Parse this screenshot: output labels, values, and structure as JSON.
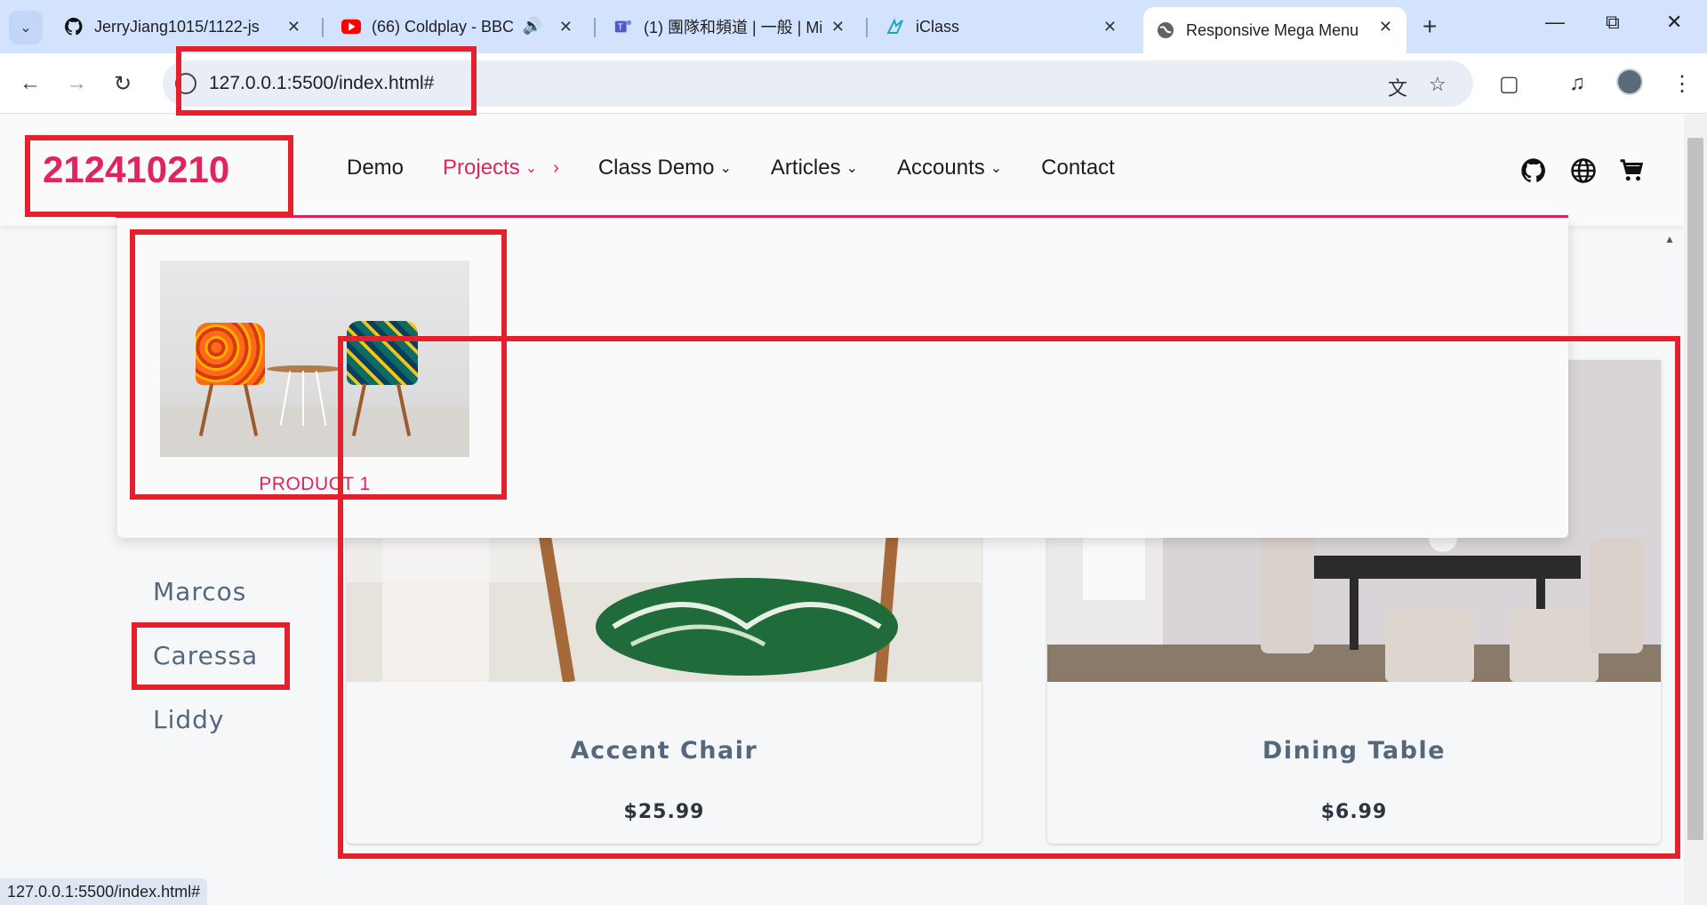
{
  "browser": {
    "tabs": [
      {
        "title": "JerryJiang1015/1122-js",
        "icon": "github-icon"
      },
      {
        "title": "(66) Coldplay - BBC",
        "icon": "youtube-icon"
      },
      {
        "title": "(1) 團隊和頻道 | 一般 | Mi",
        "icon": "teams-icon"
      },
      {
        "title": "iClass",
        "icon": "iclass-icon"
      },
      {
        "title": "Responsive Mega Menu",
        "icon": "globe-icon"
      }
    ],
    "url": "127.0.0.1:5500/index.html#",
    "status_url": "127.0.0.1:5500/index.html#"
  },
  "site": {
    "logo": "212410210",
    "menu": [
      {
        "label": "Demo",
        "has_chevron": false
      },
      {
        "label": "Projects",
        "has_chevron": true
      },
      {
        "label": "Class Demo",
        "has_chevron": true
      },
      {
        "label": "Articles",
        "has_chevron": true
      },
      {
        "label": "Accounts",
        "has_chevron": true
      },
      {
        "label": "Contact",
        "has_chevron": false
      }
    ],
    "icons": [
      "github-icon",
      "globe-icon",
      "cart-icon"
    ],
    "accent": "#e0245e"
  },
  "dropdown": {
    "product_label": "PRODUCT 1"
  },
  "sidebar": {
    "names": [
      "Marcos",
      "Caressa",
      "Liddy"
    ]
  },
  "cards": [
    {
      "name": "Accent Chair",
      "price": "$25.99"
    },
    {
      "name": "Dining Table",
      "price": "$6.99"
    }
  ]
}
